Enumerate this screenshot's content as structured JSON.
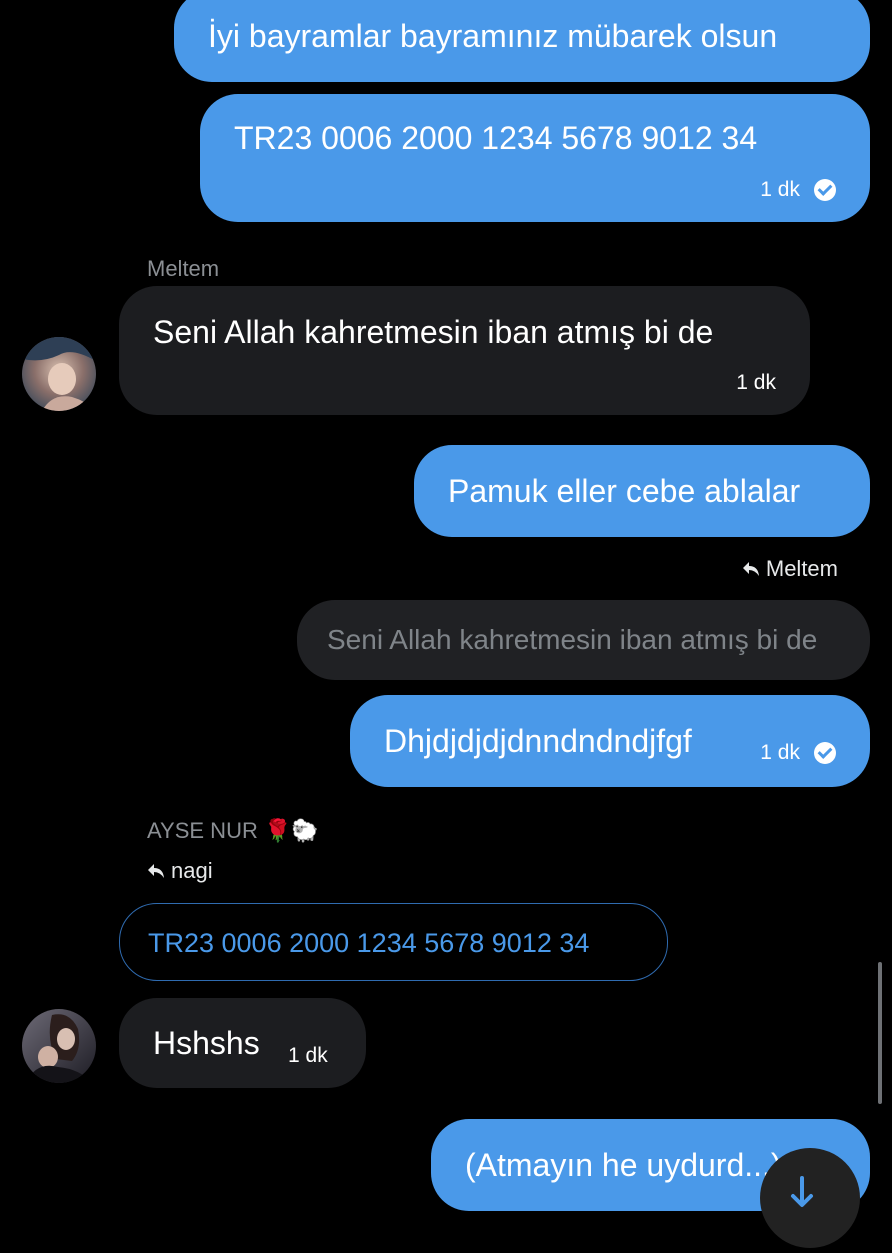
{
  "messages": {
    "m1": {
      "text": "İyi bayramlar bayramınız mübarek olsun"
    },
    "m2": {
      "text": "TR23 0006 2000 1234 5678 9012 34",
      "time": "1 dk"
    },
    "m3": {
      "sender": "Meltem",
      "text": "Seni Allah kahretmesin iban atmış bi de",
      "time": "1 dk"
    },
    "m4": {
      "text": "Pamuk eller cebe ablalar"
    },
    "m5": {
      "reply_to": "Meltem",
      "quoted": "Seni Allah kahretmesin iban atmış bi de",
      "text": "Dhjdjdjdjdnndndndjfgf",
      "time": "1 dk"
    },
    "m6": {
      "sender": "AYSE NUR 🌹🐑",
      "reply_to": "nagi",
      "quoted": "TR23 0006 2000 1234 5678 9012 34",
      "text": "Hshshs",
      "time": "1 dk"
    },
    "m7": {
      "text": "(Atmayın he uydurd...)"
    }
  },
  "icons": {
    "read_receipt": "check-circle-icon",
    "reply": "reply-arrow-icon",
    "scroll_down": "arrow-down-icon"
  },
  "colors": {
    "background": "#000000",
    "outgoing_bubble": "#4a99e9",
    "incoming_bubble": "#1c1d20",
    "secondary_text": "#8b8f94",
    "quoted_link": "#4a99e9"
  }
}
